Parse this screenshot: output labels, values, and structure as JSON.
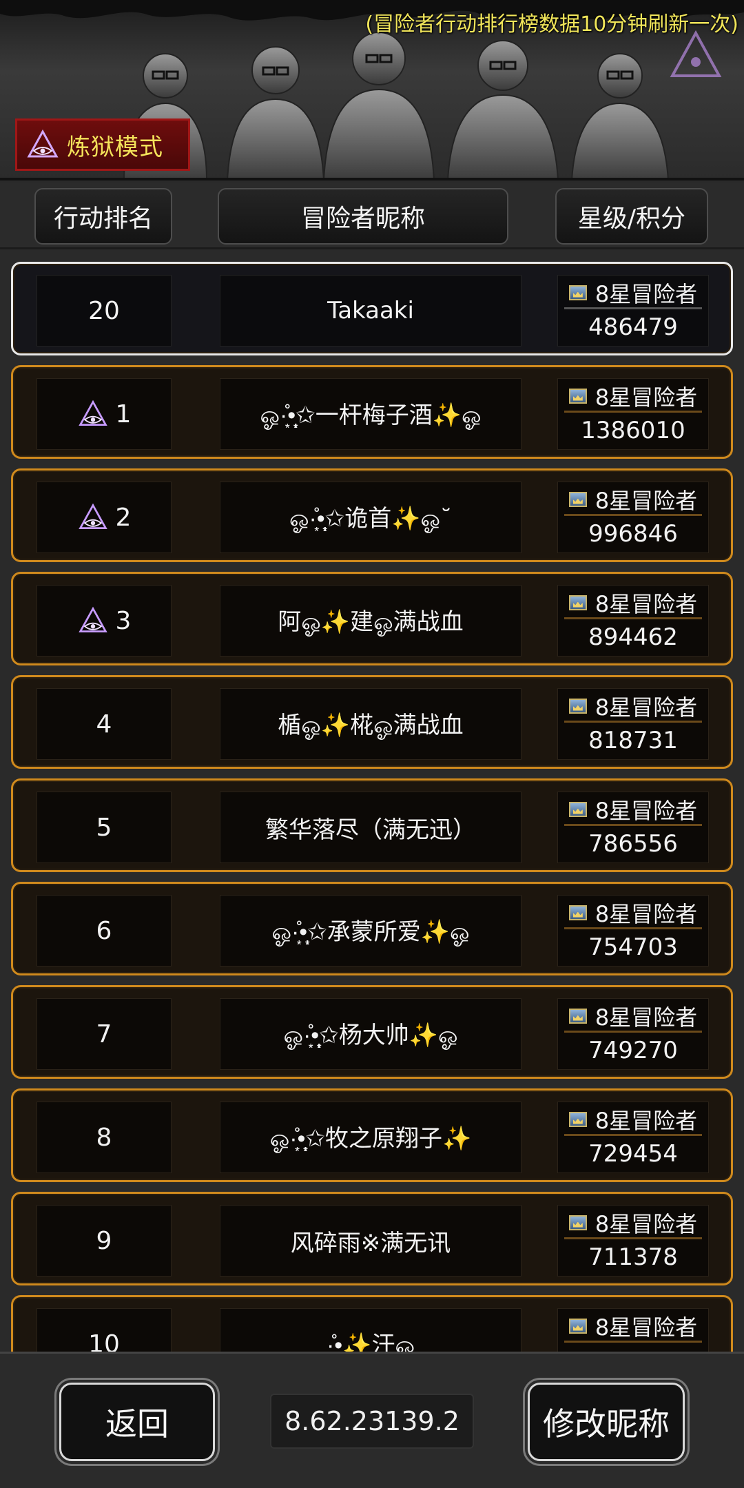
{
  "banner": {
    "notice": "(冒险者行动排行榜数据10分钟刷新一次)",
    "mode_label": "炼狱模式"
  },
  "header": {
    "rank_label": "行动排名",
    "name_label": "冒险者昵称",
    "score_label": "星级/积分"
  },
  "self_row": {
    "rank": "20",
    "name": "Takaaki",
    "level": "8星冒险者",
    "score": "486479"
  },
  "rows": [
    {
      "rank": "1",
      "name": "ஓ·͙̊•̩̩͙✩一杆梅子酒✨ஓ",
      "level": "8星冒险者",
      "score": "1386010",
      "top": true
    },
    {
      "rank": "2",
      "name": "ஓ·͙̊•̩̩͙✩诡首✨ஓ˘",
      "level": "8星冒险者",
      "score": "996846",
      "top": true
    },
    {
      "rank": "3",
      "name": "阿ஓ✨建ஓ满战血",
      "level": "8星冒险者",
      "score": "894462",
      "top": true
    },
    {
      "rank": "4",
      "name": "楯ஓ✨椛ஓ满战血",
      "level": "8星冒险者",
      "score": "818731",
      "top": false
    },
    {
      "rank": "5",
      "name": "繁华落尽（满无迅）",
      "level": "8星冒险者",
      "score": "786556",
      "top": false
    },
    {
      "rank": "6",
      "name": "ஓ·͙̊•̩̩͙✩承蒙所爱✨ஓ",
      "level": "8星冒险者",
      "score": "754703",
      "top": false
    },
    {
      "rank": "7",
      "name": "ஓ·͙̊•̩̩͙✩杨大帅✨ஓ",
      "level": "8星冒险者",
      "score": "749270",
      "top": false
    },
    {
      "rank": "8",
      "name": "ஓ·͙̊•̩̩͙✩牧之原翔子✨",
      "level": "8星冒险者",
      "score": "729454",
      "top": false
    },
    {
      "rank": "9",
      "name": "风碎雨※满无讯",
      "level": "8星冒险者",
      "score": "711378",
      "top": false
    },
    {
      "rank": "10",
      "name": "·͙̊•̩̩͙✨汗ஓ",
      "level": "8星冒险者",
      "score": "",
      "top": false
    }
  ],
  "footer": {
    "back_label": "返回",
    "version": "8.62.23139.2",
    "rename_label": "修改昵称"
  },
  "colors": {
    "accent_gold": "#d08a1d",
    "notice_yellow": "#f1e65a",
    "badge_red": "#6e0d0d"
  },
  "icons": {
    "rank_top": "purple-triangle-eye-icon",
    "level": "crown-badge-icon"
  }
}
